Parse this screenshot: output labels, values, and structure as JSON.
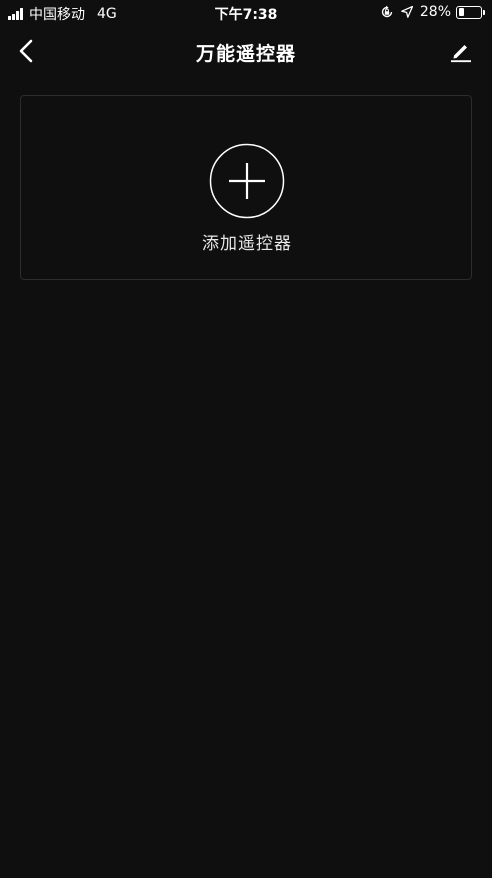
{
  "status_bar": {
    "carrier": "中国移动",
    "network": "4G",
    "time": "下午7:38",
    "battery_percent": "28%",
    "battery_level": 0.28
  },
  "nav": {
    "title": "万能遥控器"
  },
  "add_card": {
    "label": "添加遥控器"
  },
  "icons": {
    "back": "chevron-left-icon",
    "edit": "pencil-icon",
    "add": "plus-circle-icon",
    "rotation_lock": "rotation-lock-icon",
    "location": "location-arrow-icon"
  },
  "colors": {
    "background": "#0f0f0f",
    "text": "#ffffff",
    "card_border": "#2c2c2c"
  }
}
